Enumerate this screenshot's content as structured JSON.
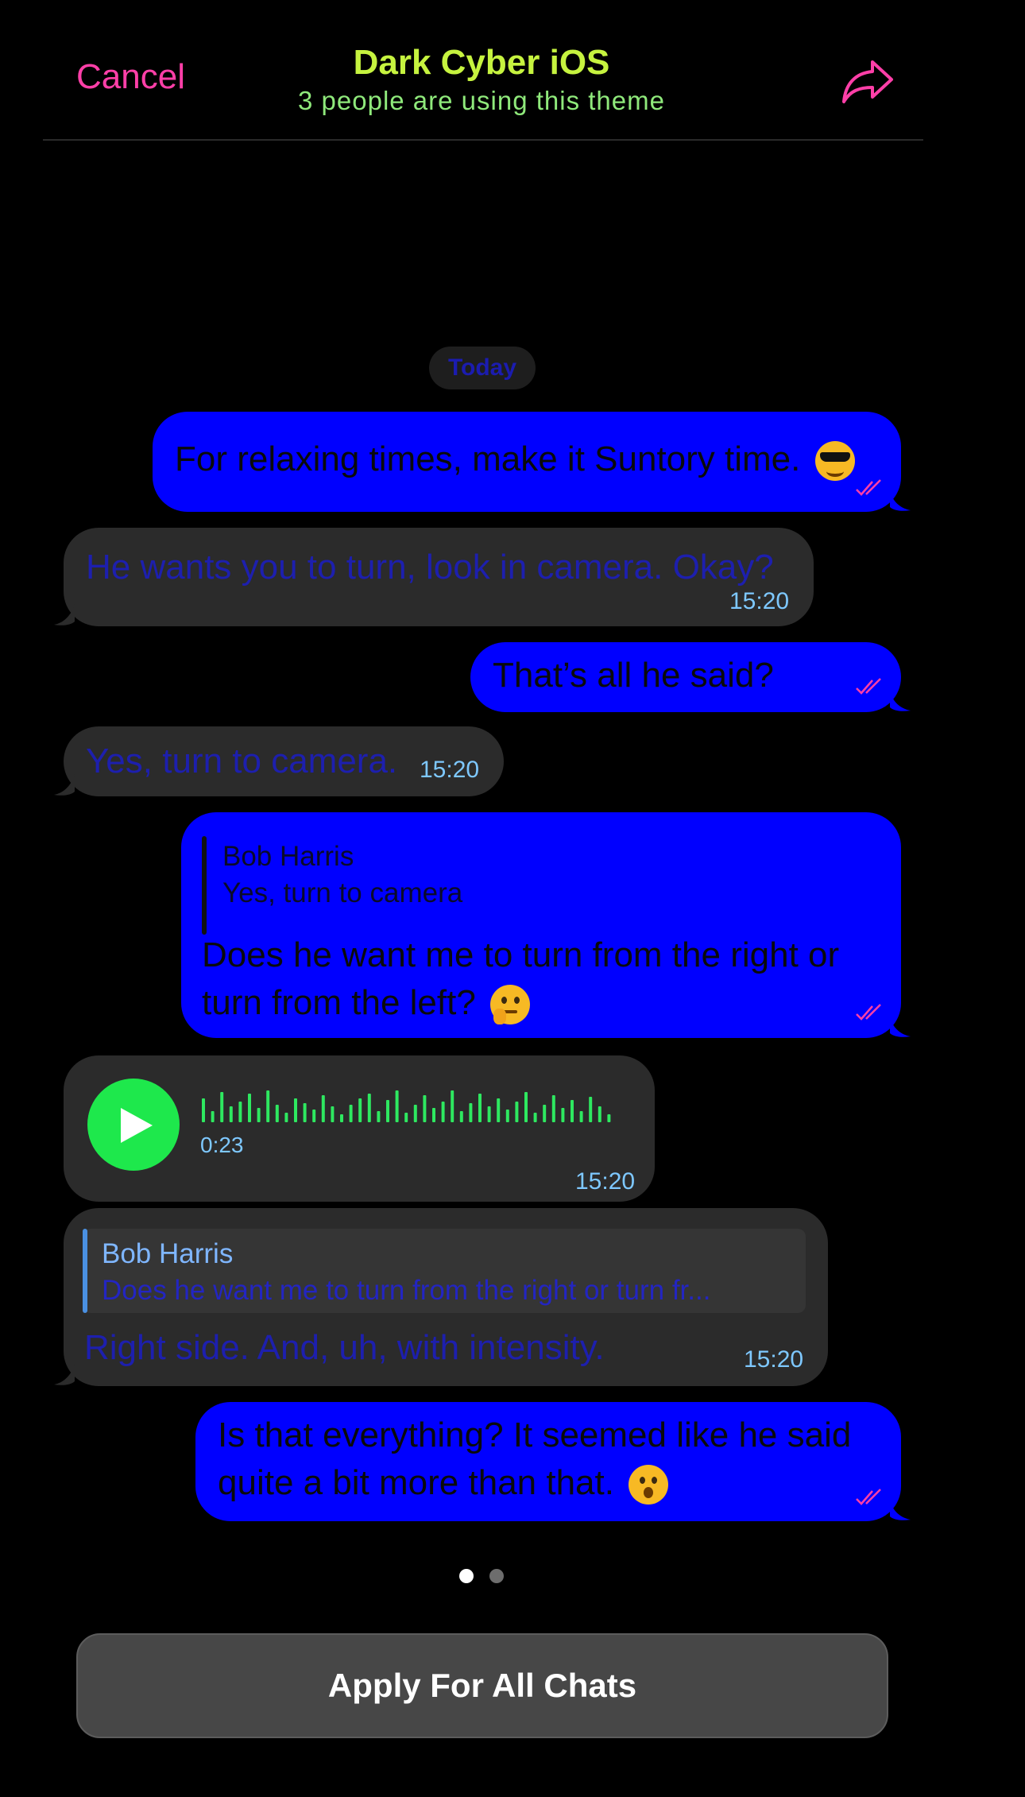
{
  "header": {
    "cancel_label": "Cancel",
    "title": "Dark Cyber iOS",
    "subtitle": "3 people are using this theme",
    "share_icon": "share-arrow-icon"
  },
  "date_pill": "Today",
  "messages": [
    {
      "direction": "out",
      "text": "For relaxing times, make it Suntory time.",
      "emoji": "smiling-face-with-sunglasses"
    },
    {
      "direction": "in",
      "text": "He wants you to turn, look in camera. Okay?",
      "time": "15:20"
    },
    {
      "direction": "out",
      "text": "That’s all he said?"
    },
    {
      "direction": "in",
      "text": "Yes, turn to camera.",
      "time": "15:20"
    },
    {
      "direction": "out",
      "reply_name": "Bob Harris",
      "reply_text": "Yes, turn to camera",
      "text_line1": "Does he want me to turn from the right or",
      "text_line2": "turn from the left?",
      "emoji": "thinking-face"
    },
    {
      "direction": "in",
      "type": "voice",
      "duration": "0:23",
      "time": "15:20"
    },
    {
      "direction": "in",
      "reply_name": "Bob Harris",
      "reply_text": "Does he want me to turn from the right or turn fr...",
      "text": "Right side. And, uh, with intensity.",
      "time": "15:20"
    },
    {
      "direction": "out",
      "text_line1": "Is that everything? It seemed like he said",
      "text_line2": "quite a bit more than that.",
      "emoji": "hushed-face"
    }
  ],
  "pager": {
    "pages": 2,
    "current": 1
  },
  "apply_button_label": "Apply For All Chats",
  "colors": {
    "background": "#000000",
    "outgoing_bubble": "#0000ff",
    "incoming_bubble": "#2b2b2b",
    "accent_pink": "#ff3fa8",
    "title_green": "#c6f33f",
    "play_green": "#1ee84c",
    "time_blue": "#7ec8ff"
  }
}
